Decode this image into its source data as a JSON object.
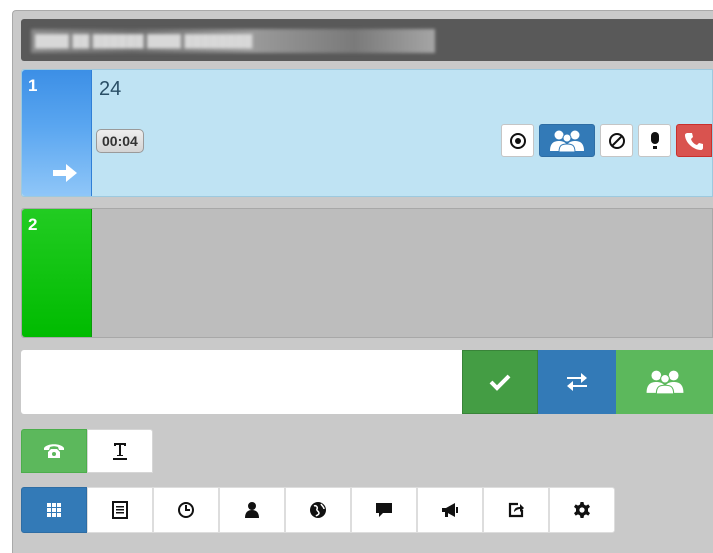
{
  "title_bar": {
    "text": "████ ██ ██████ ████ ████████"
  },
  "lines": [
    {
      "number": "1",
      "dialed": "24",
      "timer": "00:04",
      "state": "active-outgoing",
      "tab_color": "#4a9cec",
      "background": "#bfe3f3"
    },
    {
      "number": "2",
      "state": "idle",
      "tab_color": "#00bb00",
      "background": "#bdbdbd"
    }
  ],
  "call_actions": [
    {
      "name": "record",
      "icon": "record-icon"
    },
    {
      "name": "conference",
      "icon": "users-icon",
      "color": "#337ab7"
    },
    {
      "name": "reject",
      "icon": "block-icon"
    },
    {
      "name": "mute",
      "icon": "microphone-icon"
    },
    {
      "name": "hangup",
      "icon": "phone-hangup-icon",
      "color": "#d9534f"
    }
  ],
  "dial": {
    "value": "",
    "placeholder": "",
    "buttons": [
      {
        "name": "call",
        "icon": "check-icon",
        "color": "#449d44"
      },
      {
        "name": "transfer",
        "icon": "transfer-icon",
        "color": "#337ab7"
      },
      {
        "name": "conference",
        "icon": "users-icon",
        "color": "#5cb85c"
      }
    ]
  },
  "mode_tabs": [
    {
      "name": "phone",
      "icon": "phone-icon",
      "active": true,
      "color": "#5cb85c"
    },
    {
      "name": "text",
      "icon": "text-format-icon",
      "active": false
    }
  ],
  "toolbar": [
    {
      "name": "dialpad",
      "icon": "grid-icon",
      "active": true,
      "color": "#337ab7"
    },
    {
      "name": "contacts-list",
      "icon": "list-icon",
      "active": false
    },
    {
      "name": "history",
      "icon": "clock-icon",
      "active": false
    },
    {
      "name": "contacts",
      "icon": "user-icon",
      "active": false
    },
    {
      "name": "web",
      "icon": "globe-icon",
      "active": false
    },
    {
      "name": "chat",
      "icon": "comment-icon",
      "active": false
    },
    {
      "name": "broadcast",
      "icon": "bullhorn-icon",
      "active": false
    },
    {
      "name": "logout",
      "icon": "share-icon",
      "active": false
    },
    {
      "name": "settings",
      "icon": "cog-icon",
      "active": false
    }
  ]
}
